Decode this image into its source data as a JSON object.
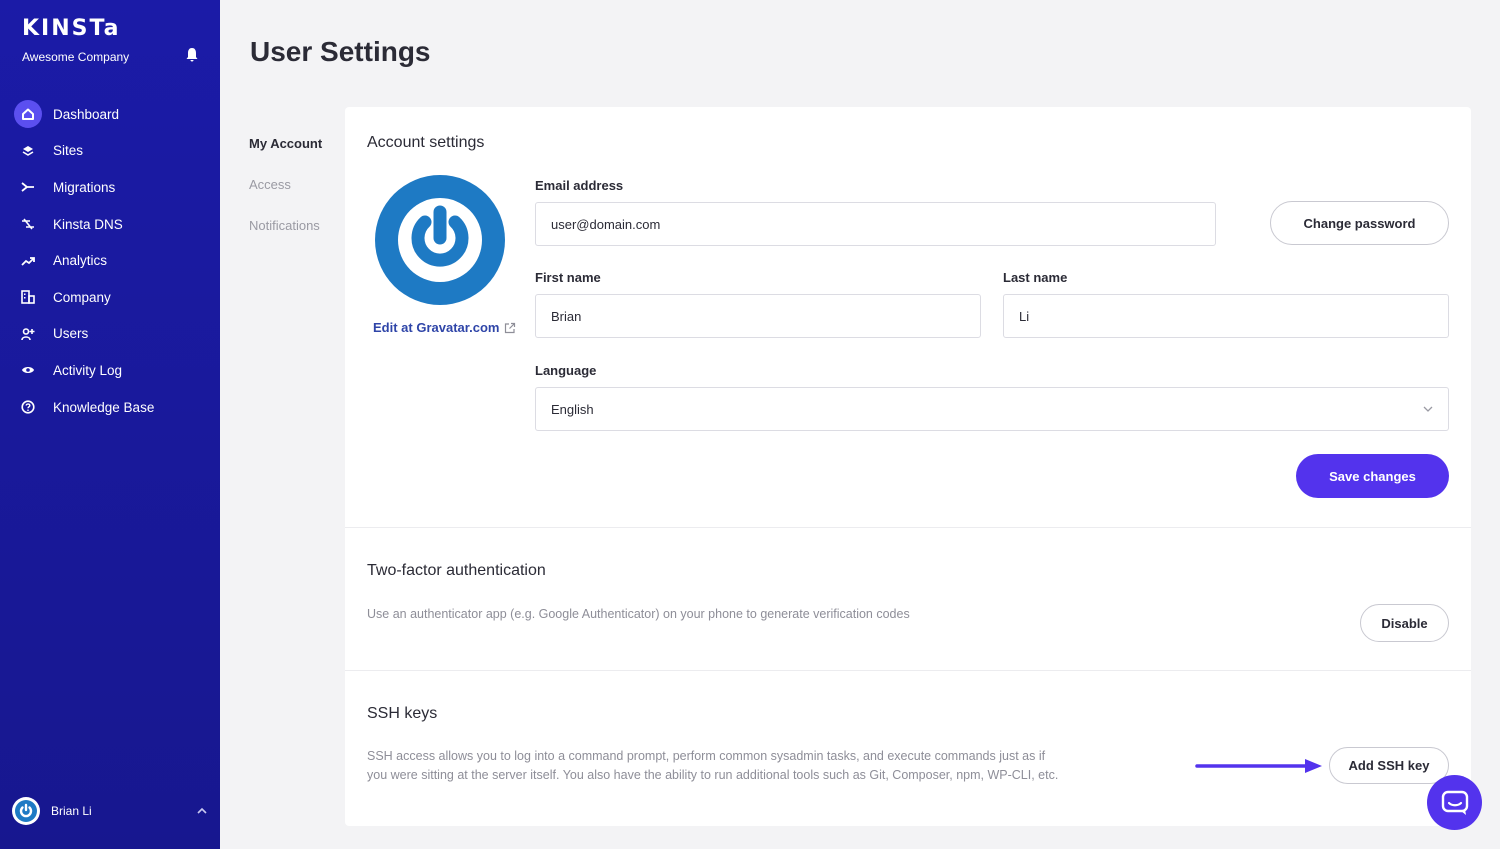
{
  "sidebar": {
    "brand": "KINSTa",
    "company": "Awesome Company",
    "items": [
      {
        "label": "Dashboard",
        "icon": "home-icon"
      },
      {
        "label": "Sites",
        "icon": "layers-icon"
      },
      {
        "label": "Migrations",
        "icon": "migrate-icon"
      },
      {
        "label": "Kinsta DNS",
        "icon": "dns-icon"
      },
      {
        "label": "Analytics",
        "icon": "trend-icon"
      },
      {
        "label": "Company",
        "icon": "building-icon"
      },
      {
        "label": "Users",
        "icon": "add-user-icon"
      },
      {
        "label": "Activity Log",
        "icon": "eye-icon"
      },
      {
        "label": "Knowledge Base",
        "icon": "help-icon"
      }
    ],
    "user_name": "Brian Li"
  },
  "page": {
    "title": "User Settings"
  },
  "subnav": [
    "My Account",
    "Access",
    "Notifications"
  ],
  "account": {
    "title": "Account settings",
    "gravatar_link": "Edit at Gravatar.com",
    "email_label": "Email address",
    "email_value": "user@domain.com",
    "change_password": "Change password",
    "first_name_label": "First name",
    "first_name_value": "Brian",
    "last_name_label": "Last name",
    "last_name_value": "Li",
    "language_label": "Language",
    "language_value": "English",
    "save": "Save changes"
  },
  "two_factor": {
    "title": "Two-factor authentication",
    "description": "Use an authenticator app (e.g. Google Authenticator) on your phone to generate verification codes",
    "button": "Disable"
  },
  "ssh": {
    "title": "SSH keys",
    "description_line1": "SSH access allows you to log into a command prompt, perform common sysadmin tasks, and execute commands just as if",
    "description_line2": "you were sitting at the server itself. You also have the ability to run additional tools such as Git, Composer, npm, WP-CLI, etc.",
    "button": "Add SSH key"
  },
  "colors": {
    "sidebar": "#1b1ba7",
    "accent": "#5333ed",
    "gravatar": "#1e7ac4"
  }
}
